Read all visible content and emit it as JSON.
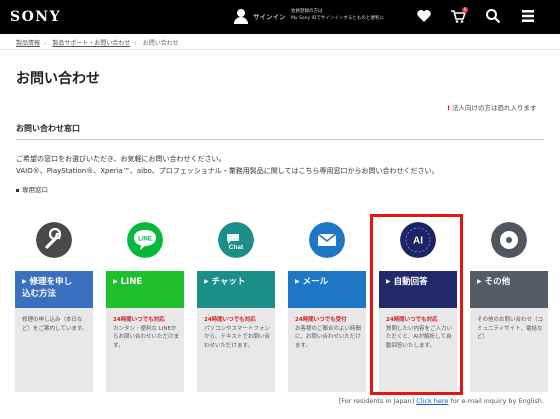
{
  "header": {
    "logo": "SONY",
    "signin_label": "サインイン",
    "signin_note_line1": "会員登録の方は",
    "signin_note_line2": "My Sony IDでサインインするとものと便利に",
    "cart_count": "0"
  },
  "breadcrumb": [
    "製品情報",
    "製品サポート・お問い合わせ",
    "お問い合わせ"
  ],
  "page_title": "お問い合わせ",
  "notice": "法人向けの方は恐れ入ります",
  "section_title": "お問い合わせ窓口",
  "intro_line1": "ご希望の窓口をお選びいただき、お気軽にお問い合わせください。",
  "intro_line2": "VAIO®、PlayStation®、Xperia™、aibo、プロフェッショナル・業務用製品に関してはこちら専用窓口からお問い合わせください。",
  "dedicated_label": "専用窓口",
  "cards": [
    {
      "label_line1": "修理を申し",
      "label_line2": "込む方法",
      "hours": "",
      "desc": "修理の申し込み（本日など）をご案内しています。",
      "color": "#3a6fbf"
    },
    {
      "label_line1": "LINE",
      "label_line2": "",
      "hours": "24時間いつでも対応",
      "desc": "カンタン・便利な LINEからお問い合わせいただけます。",
      "color": "#1ebe2c"
    },
    {
      "label_line1": "チャット",
      "label_line2": "",
      "hours": "24時間いつでも対応",
      "desc": "パソコンやスマートフォンから、テキストでお問い合わせいただけます。",
      "color": "#1b8e8a"
    },
    {
      "label_line1": "メール",
      "label_line2": "",
      "hours": "24時間いつでも受付",
      "desc": "お客様のご都合のよい時間に、お問い合わせいただけます。",
      "color": "#1d77c4"
    },
    {
      "label_line1": "自動回答",
      "label_line2": "",
      "hours": "24時間いつでも対応",
      "desc": "質問したい内容をご入力いただくと、AIが解析して自動回答いたします。",
      "color": "#222a6b"
    },
    {
      "label_line1": "その他",
      "label_line2": "",
      "hours": "",
      "desc": "その他のお問い合わせ（コミュニティサイト、電話など）",
      "color": "#545c66"
    }
  ],
  "icons": {
    "wrench": "wrench-icon",
    "line": "LINE",
    "chat": "Chat",
    "mail": "mail-icon",
    "ai": "AI",
    "other": "disc-icon"
  },
  "footer": {
    "prefix": "[For residents in Japan]",
    "link": "Click here",
    "suffix": "for e-mail inquiry by English."
  }
}
